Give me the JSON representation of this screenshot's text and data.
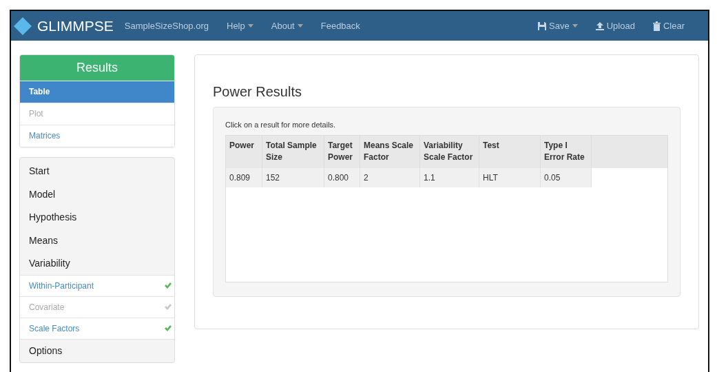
{
  "navbar": {
    "brand": "GLIMMPSE",
    "links": [
      {
        "label": "SampleSizeShop.org",
        "dropdown": false
      },
      {
        "label": "Help",
        "dropdown": true
      },
      {
        "label": "About",
        "dropdown": true
      },
      {
        "label": "Feedback",
        "dropdown": false
      }
    ],
    "actions": [
      {
        "label": "Save",
        "kind": "save",
        "dropdown": true
      },
      {
        "label": "Upload",
        "kind": "upload",
        "dropdown": false
      },
      {
        "label": "Clear",
        "kind": "clear",
        "dropdown": false
      }
    ]
  },
  "results_menu": {
    "title": "Results",
    "items": [
      {
        "label": "Table",
        "selected": true,
        "disabled": false
      },
      {
        "label": "Plot",
        "selected": false,
        "disabled": true
      },
      {
        "label": "Matrices",
        "selected": false,
        "disabled": false
      }
    ]
  },
  "steps": [
    {
      "label": "Start",
      "kind": "section"
    },
    {
      "label": "Model",
      "kind": "section"
    },
    {
      "label": "Hypothesis",
      "kind": "section"
    },
    {
      "label": "Means",
      "kind": "section"
    },
    {
      "label": "Variability",
      "kind": "section"
    },
    {
      "label": "Within-Participant",
      "kind": "sub",
      "disabled": false,
      "checked": true
    },
    {
      "label": "Covariate",
      "kind": "sub",
      "disabled": true,
      "checked": true
    },
    {
      "label": "Scale Factors",
      "kind": "sub",
      "disabled": false,
      "checked": true
    },
    {
      "label": "Options",
      "kind": "section"
    }
  ],
  "main": {
    "title": "Power Results",
    "hint": "Click on a result for more details.",
    "table": {
      "columns": [
        "Power",
        "Total Sample Size",
        "Target Power",
        "Means Scale Factor",
        "Variability Scale Factor",
        "Test",
        "Type I Error Rate"
      ],
      "rows": [
        [
          "0.809",
          "152",
          "0.800",
          "2",
          "1.1",
          "HLT",
          "0.05"
        ]
      ]
    }
  }
}
